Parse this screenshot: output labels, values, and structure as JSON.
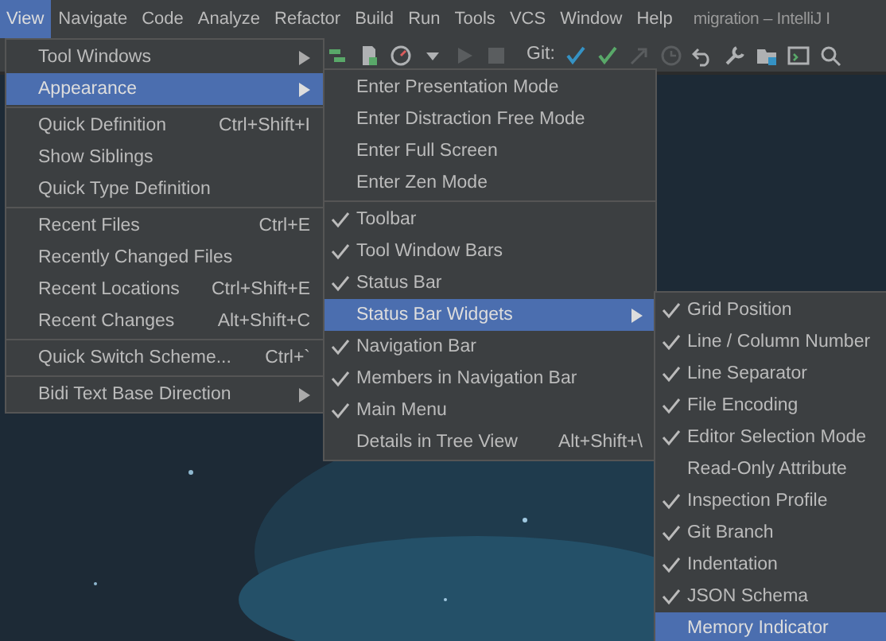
{
  "menu_bar": [
    {
      "label": "View",
      "selected": true
    },
    {
      "label": "Navigate",
      "selected": false
    },
    {
      "label": "Code",
      "selected": false
    },
    {
      "label": "Analyze",
      "selected": false
    },
    {
      "label": "Refactor",
      "selected": false
    },
    {
      "label": "Build",
      "selected": false
    },
    {
      "label": "Run",
      "selected": false
    },
    {
      "label": "Tools",
      "selected": false
    },
    {
      "label": "VCS",
      "selected": false
    },
    {
      "label": "Window",
      "selected": false
    },
    {
      "label": "Help",
      "selected": false
    }
  ],
  "window_title": "migration – IntelliJ I",
  "toolbar": {
    "git_label": "Git:"
  },
  "menus": [
    {
      "items": [
        {
          "label": "Tool Windows",
          "submenu": true,
          "selected": false
        },
        {
          "label": "Appearance",
          "submenu": true,
          "selected": true
        },
        {
          "kind": "separator"
        },
        {
          "label": "Quick Definition",
          "shortcut": "Ctrl+Shift+I",
          "selected": false
        },
        {
          "label": "Show Siblings",
          "selected": false
        },
        {
          "label": "Quick Type Definition",
          "selected": false
        },
        {
          "kind": "separator"
        },
        {
          "label": "Recent Files",
          "shortcut": "Ctrl+E",
          "selected": false
        },
        {
          "label": "Recently Changed Files",
          "selected": false
        },
        {
          "label": "Recent Locations",
          "shortcut": "Ctrl+Shift+E",
          "selected": false
        },
        {
          "label": "Recent Changes",
          "shortcut": "Alt+Shift+C",
          "selected": false
        },
        {
          "kind": "separator"
        },
        {
          "label": "Quick Switch Scheme...",
          "shortcut": "Ctrl+`",
          "selected": false
        },
        {
          "kind": "separator"
        },
        {
          "label": "Bidi Text Base Direction",
          "submenu": true,
          "selected": false
        }
      ]
    },
    {
      "items": [
        {
          "label": "Enter Presentation Mode",
          "checked": false,
          "selected": false
        },
        {
          "label": "Enter Distraction Free Mode",
          "checked": false,
          "selected": false
        },
        {
          "label": "Enter Full Screen",
          "checked": false,
          "selected": false
        },
        {
          "label": "Enter Zen Mode",
          "checked": false,
          "selected": false
        },
        {
          "kind": "separator"
        },
        {
          "label": "Toolbar",
          "checked": true,
          "selected": false
        },
        {
          "label": "Tool Window Bars",
          "checked": true,
          "selected": false
        },
        {
          "label": "Status Bar",
          "checked": true,
          "selected": false
        },
        {
          "label": "Status Bar Widgets",
          "checked": false,
          "submenu": true,
          "selected": true
        },
        {
          "label": "Navigation Bar",
          "checked": true,
          "selected": false
        },
        {
          "label": "Members in Navigation Bar",
          "checked": true,
          "selected": false
        },
        {
          "label": "Main Menu",
          "checked": true,
          "selected": false
        },
        {
          "label": "Details in Tree View",
          "checked": false,
          "shortcut": "Alt+Shift+\\",
          "selected": false
        }
      ]
    },
    {
      "items": [
        {
          "label": "Grid Position",
          "checked": true,
          "selected": false
        },
        {
          "label": "Line / Column Number",
          "checked": true,
          "selected": false
        },
        {
          "label": "Line Separator",
          "checked": true,
          "selected": false
        },
        {
          "label": "File Encoding",
          "checked": true,
          "selected": false
        },
        {
          "label": "Editor Selection Mode",
          "checked": true,
          "selected": false
        },
        {
          "label": "Read-Only Attribute",
          "checked": false,
          "selected": false
        },
        {
          "label": "Inspection Profile",
          "checked": true,
          "selected": false
        },
        {
          "label": "Git Branch",
          "checked": true,
          "selected": false
        },
        {
          "label": "Indentation",
          "checked": true,
          "selected": false
        },
        {
          "label": "JSON Schema",
          "checked": true,
          "selected": false
        },
        {
          "label": "Memory Indicator",
          "checked": false,
          "selected": true
        }
      ]
    }
  ]
}
